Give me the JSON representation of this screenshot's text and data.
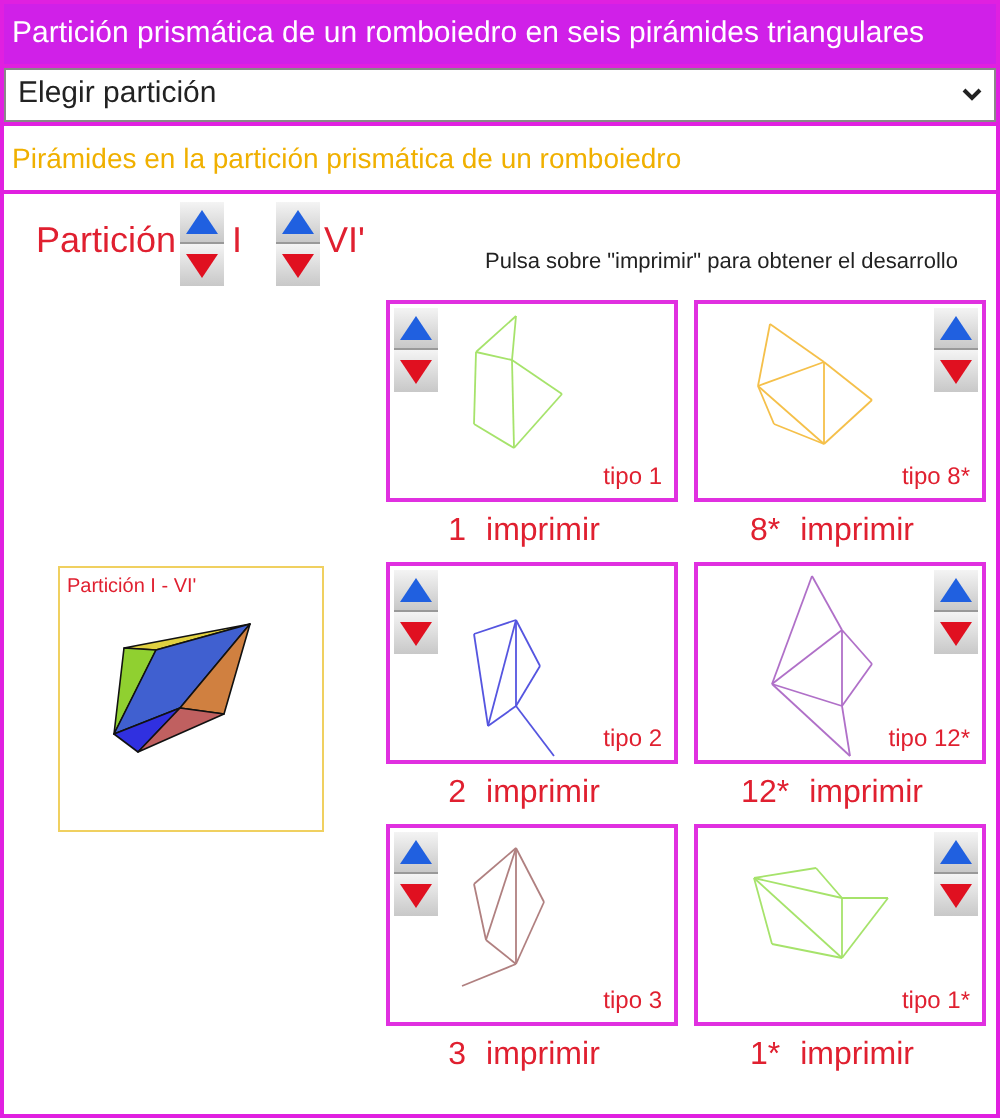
{
  "title": "Partición prismática de un  romboiedro  en seis pirámides triangulares",
  "select": {
    "value": "Elegir partición"
  },
  "subtitle": "Pirámides en la partición prismática de un  romboiedro",
  "partition": {
    "label": "Partición",
    "from": "I",
    "to": "VI'"
  },
  "instruction": "Pulsa sobre \"imprimir\" para obtener el desarrollo",
  "preview": {
    "caption": "Partición I - VI'"
  },
  "cards": [
    {
      "tipo": "tipo 1",
      "number": "1",
      "action": "imprimir",
      "color": "#a6e36b",
      "kind": "left"
    },
    {
      "tipo": "tipo 8*",
      "number": "8*",
      "action": "imprimir",
      "color": "#f5c04a",
      "kind": "right"
    },
    {
      "tipo": "tipo 2",
      "number": "2",
      "action": "imprimir",
      "color": "#5555e0",
      "kind": "left"
    },
    {
      "tipo": "tipo 12*",
      "number": "12*",
      "action": "imprimir",
      "color": "#b070c8",
      "kind": "right"
    },
    {
      "tipo": "tipo 3",
      "number": "3",
      "action": "imprimir",
      "color": "#b08080",
      "kind": "left"
    },
    {
      "tipo": "tipo 1*",
      "number": "1*",
      "action": "imprimir",
      "color": "#a6e36b",
      "kind": "right"
    }
  ]
}
